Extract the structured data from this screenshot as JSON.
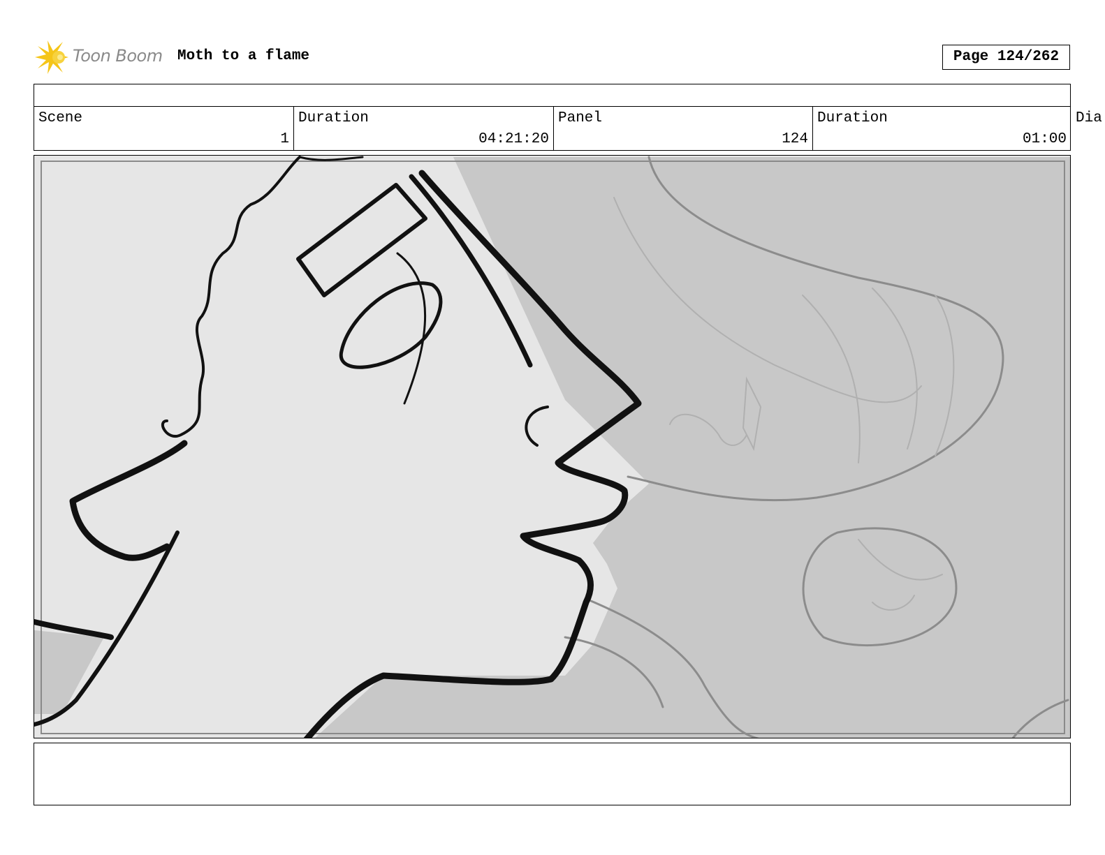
{
  "header": {
    "logo_text": "Toon Boom",
    "project_title": "Moth to a flame",
    "page_label": "Page 124/262"
  },
  "info": {
    "scene_label": "Scene",
    "scene_value": "1",
    "scene_duration_label": "Duration",
    "scene_duration_value": "04:21:20",
    "panel_label": "Panel",
    "panel_value": "124",
    "panel_duration_label": "Duration",
    "panel_duration_value": "01:00",
    "dialogue_label": "Dia"
  },
  "notes": {
    "text": ""
  }
}
